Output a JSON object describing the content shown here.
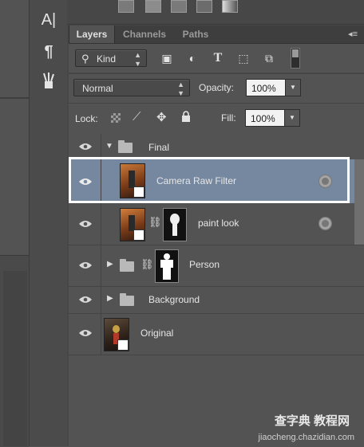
{
  "tools": {
    "char_icon": "A|",
    "para_icon": "¶",
    "brush_icon": "brush-presets"
  },
  "tabs": [
    {
      "label": "Layers",
      "active": true
    },
    {
      "label": "Channels",
      "active": false
    },
    {
      "label": "Paths",
      "active": false
    }
  ],
  "filter": {
    "kind_label": "Kind",
    "icons": [
      "image-filter-icon",
      "adjustment-filter-icon",
      "text-filter-icon",
      "shape-filter-icon",
      "smart-object-filter-icon"
    ]
  },
  "blend": {
    "mode": "Normal",
    "opacity_label": "Opacity:",
    "opacity_value": "100%"
  },
  "lock": {
    "label": "Lock:",
    "fill_label": "Fill:",
    "fill_value": "100%"
  },
  "layers": [
    {
      "name": "Final",
      "type": "group",
      "expanded": true
    },
    {
      "name": "Camera Raw Filter",
      "type": "smart-object",
      "selected": true
    },
    {
      "name": "paint look",
      "type": "smart-object-masked"
    },
    {
      "name": "Person",
      "type": "group-masked",
      "expanded": false
    },
    {
      "name": "Background",
      "type": "group",
      "expanded": false
    },
    {
      "name": "Original",
      "type": "smart-object"
    }
  ],
  "watermark": {
    "brand": "查字典 教程网",
    "url": "jiaocheng.chazidian.com"
  },
  "colors": {
    "panel": "#535353",
    "selected_row": "#7688a0",
    "outline": "#ffffff"
  }
}
